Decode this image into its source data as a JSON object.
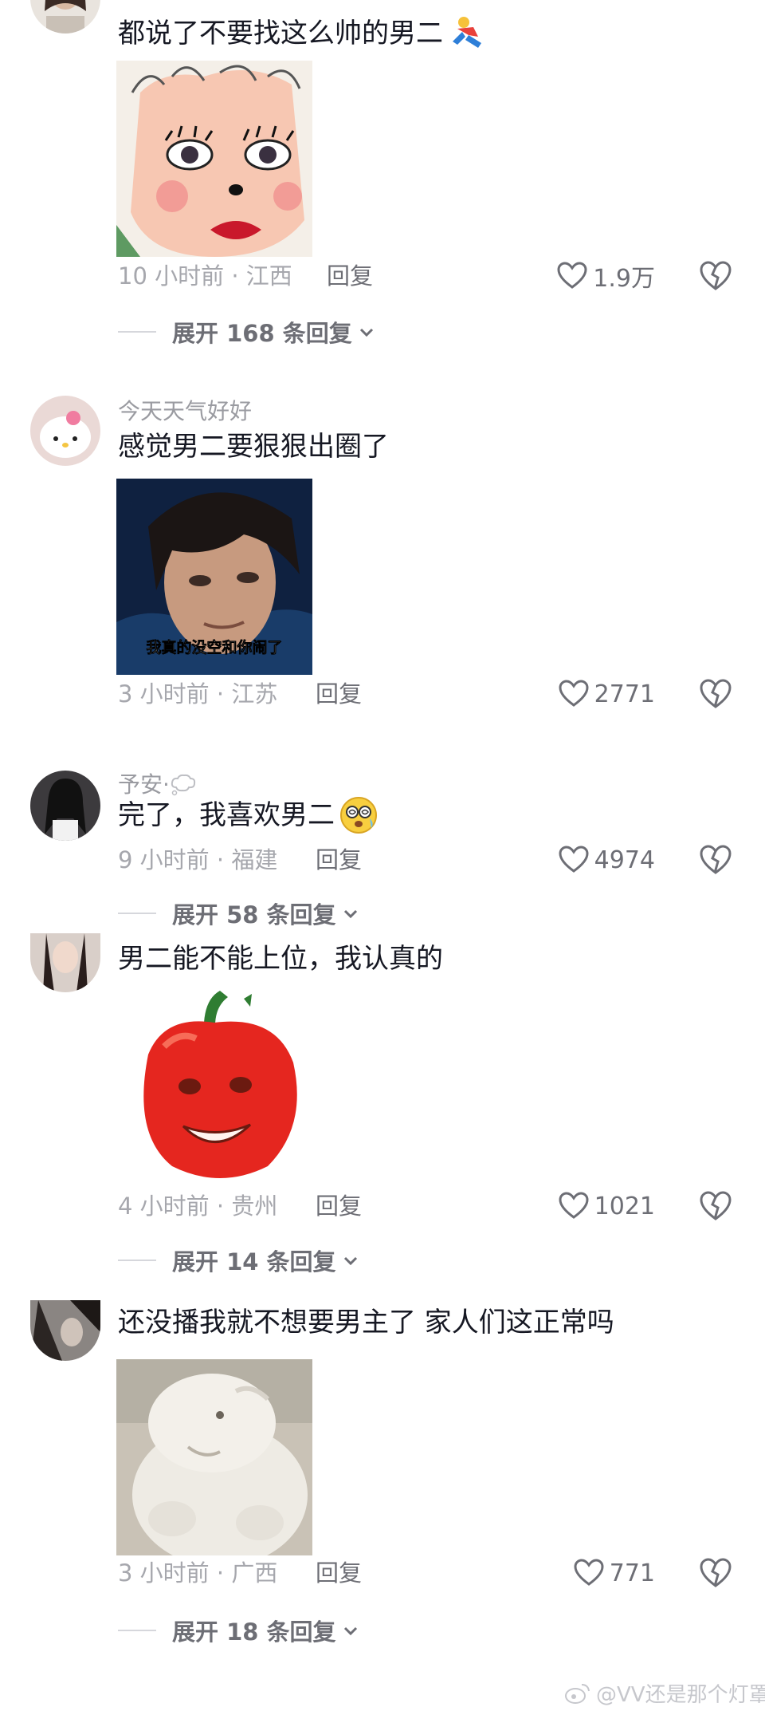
{
  "comments": [
    {
      "username": "",
      "text": "都说了不要找这么帅的男二",
      "inline_emoji": "running-man-emoji",
      "sticker": "cartoon-face-sticker",
      "time_location": "10 小时前 · 江西",
      "reply_label": "回复",
      "likes": "1.9万",
      "expand_label": "展开 168 条回复"
    },
    {
      "username": "今天天气好好",
      "text": "感觉男二要狠狠出圈了",
      "sticker": "man-face-sticker",
      "sticker_caption": "我真的没空和你闹了",
      "time_location": "3 小时前 · 江苏",
      "reply_label": "回复",
      "likes": "2771"
    },
    {
      "username": "予安·",
      "username_icon": "thought-bubble-icon",
      "text": "完了，我喜欢男二",
      "inline_emoji": "dizzy-face-emoji",
      "time_location": "9 小时前 · 福建",
      "reply_label": "回复",
      "likes": "4974",
      "expand_label": "展开 58 条回复"
    },
    {
      "username": "",
      "text": "男二能不能上位，我认真的",
      "sticker": "tomato-face-sticker",
      "time_location": "4 小时前 · 贵州",
      "reply_label": "回复",
      "likes": "1021",
      "expand_label": "展开 14 条回复"
    },
    {
      "username": "",
      "text": "还没播我就不想要男主了  家人们这正常吗",
      "sticker": "fluffy-animal-sticker",
      "time_location": "3 小时前 · 广西",
      "reply_label": "回复",
      "likes": "771",
      "expand_label": "展开 18 条回复"
    }
  ],
  "watermark": "@VV还是那个灯罩",
  "colors": {
    "primary_text": "#161823",
    "secondary_text": "#a6a7ad",
    "action_text": "#6d6e75"
  }
}
